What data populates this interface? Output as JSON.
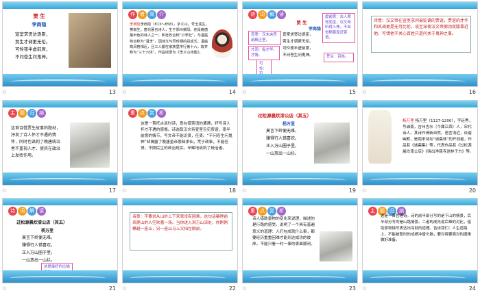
{
  "slides": [
    {
      "num": "13",
      "title": "贾 生",
      "author": "李商隐",
      "lines": [
        "宣室求贤访逐臣，",
        "贾生才调更无伦。",
        "可怜夜半虚前席，",
        "不问苍生问鬼神。"
      ]
    },
    {
      "num": "14",
      "badges": [
        "作",
        "者",
        "简",
        "介"
      ],
      "text": "李商隐（813～858），字义山，号玉溪生，樊南生。唐代著名诗人，生于郑州荥阳。他是晚唐最出色的诗人之一，和杜牧合称“小李杜”，与温庭筠合称为“温李”，因诗文与同时期的段成式、温庭筠风格相近，且三人都在家族里排行第十六，故并称为“三十六体”。作品收录为《李义山诗集》。",
      "highlight": "李商隐"
    },
    {
      "num": "15",
      "badges": [
        "诗",
        "词",
        "解",
        "读"
      ],
      "title": "贾 生",
      "author": "李商隐",
      "lines": [
        "宣室求贤访逐臣，",
        "贾生才调更无伦。",
        "可怜夜半虚前席，",
        "不问苍生问鬼神。"
      ],
      "notes": [
        "宣室：汉未央宫前殿正室。",
        "才调：指才华，才情。",
        "可怜：可惜。",
        "虚前席：古人席地而坐，汉文帝听得入神，不自觉移膝靠近贾谊。",
        "苍生：百姓。"
      ]
    },
    {
      "num": "16",
      "text": "诗意：汉文帝在宣室求问被贬谪的贾谊，贾谊的才华和风调更是无可比伦。谈至深夜汉文帝挪动双膝靠近他，可惜他不关心百姓只是问关于鬼神之事。",
      "label": "诗意："
    },
    {
      "num": "17",
      "badges": [
        "主",
        "题",
        "归",
        "纳"
      ],
      "text": "这首诗借贾生故事的题材，抒发了诗人怀才不遇的情怀，同时也讽刺了晚唐统治者不重视人才、使其在政治上发挥作用。"
    },
    {
      "num": "18",
      "badges": [
        "重",
        "点",
        "赏",
        "析"
      ],
      "text": "这是一首托古讽时诗，意在借贾谊的遭遇，抒写诗人怀才不遇的感慨。诗选取汉文帝宣室召见贾谊，夜半前席的情节，写文帝不能识贤，任贤。“不问苍生问鬼神”却揭露了晚唐皇帝愚昧求仙，荒于政事，不能任贤，不顾民生的政治现实。辛辣地讽刺了统治者。",
      "highlights": [
        "托古讽时诗",
        "怀才不遇的感慨"
      ]
    },
    {
      "num": "19",
      "title": "过松源晨炊漆公店（其五）",
      "author": "杨万里",
      "lines": [
        "莫言下岭便无难，",
        "赚得行人错喜欢。",
        "正入万山圈子里，",
        "一山放出一山拦。"
      ]
    },
    {
      "num": "20",
      "text": "杨万里（1127-1206），字廷秀，号诚斋，吉州吉水（今属江西）人，宋代诗人。其诗作清新自然，语言浅近，诙谐幽默，是南宋诗坛“诚斋体”的开创者，作品有《诚斋集》等，代表作品有《过松源晨炊漆公店》《晓出净慈寺送林子方》等。",
      "highlight": "杨万里"
    },
    {
      "num": "21",
      "badges": [
        "诗",
        "词",
        "解",
        "读"
      ],
      "title": "过松源晨炊漆公店（其五）",
      "author": "杨万里",
      "lines": [
        "莫言下岭便无难，",
        "赚得行人错喜欢。",
        "正入万山圈子里，",
        "一山放出一山拦。"
      ],
      "note": "这是最好的比喻形象"
    },
    {
      "num": "22",
      "text": "诗意：不要说从山岭上下来就没有困难，这句话骗得前来爬山的人空欢喜一场。当你进入到万山深处，你刚刚攀越一座山，另一座山马上又挡在眼前。",
      "label": "诗意："
    },
    {
      "num": "23",
      "badges": [
        "重",
        "点",
        "赏",
        "析"
      ],
      "text": "诗人借助景物的变化来说理，描述的是行路的感受。说明了一个具有普遍意义的道理：人们在成就什么事，都要经历重重困难才能到达成功的彼岸，不能只看一时一事的表面顺利。",
      "highlight": "人们在成就什么事，都要经历重重困难"
    },
    {
      "num": "24",
      "badges": [
        "主",
        "题",
        "归",
        "纳"
      ],
      "text": "这是一首哲理诗。诗的前半部分写的是下山的情景，后半部分写的是山路情景。二者构成先易后难的对比，借助景物描写表达出深刻的道理。告诉我们：人生道路上，不能被暂时的成绩冲昏头脑，要对将要面对的困难做好准备。",
      "highlights": [
        "哲理诗",
        "山路",
        "二者"
      ]
    }
  ]
}
